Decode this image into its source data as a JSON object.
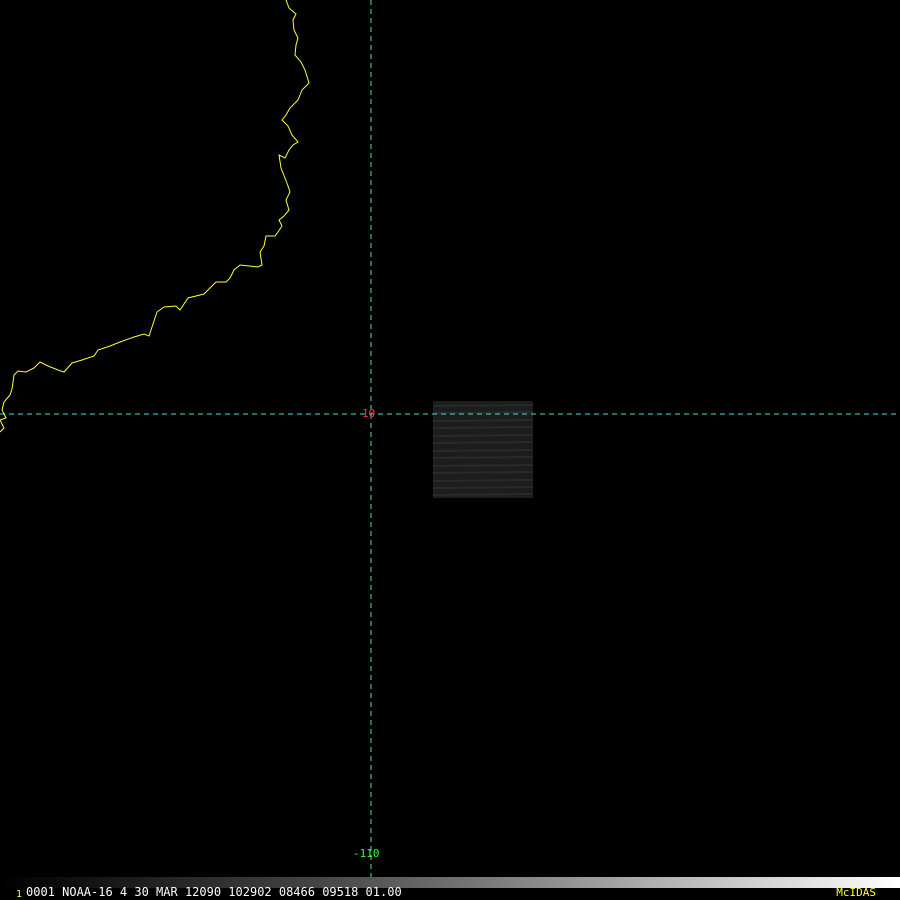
{
  "colors": {
    "background": "#000000",
    "coastline": "#ffff33",
    "gridline": "#4fd6d6",
    "latitude_label": "#ff3333",
    "longitude_label": "#33ff33",
    "frame_number": "#ffff33",
    "brand": "#ffff33"
  },
  "map": {
    "latitude_label": "10",
    "longitude_label": "-110",
    "imagery_patch": "satellite data swath (gray striped)"
  },
  "status": {
    "frame_number": "1",
    "text": "0001 NOAA-16     4 30 MAR 12090 102902 08466 09518 01.00",
    "brand": "McIDAS"
  },
  "icons": {
    "coastline": "coastline-trace",
    "grid": "lat-lon-graticule"
  }
}
